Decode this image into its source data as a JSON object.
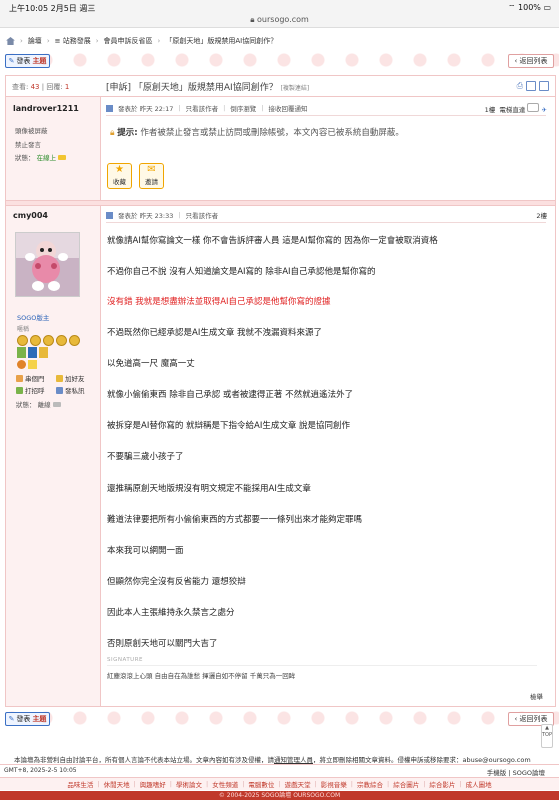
{
  "statusbar": {
    "time": "上午10:05",
    "date": "2月5日 週三",
    "battery": "100%",
    "url": "oursogo.com"
  },
  "breadcrumb": [
    "論壇",
    "站務發展",
    "會員申訴反省區",
    "「原創天地」版規禁用AI協同創作？"
  ],
  "buttons": {
    "post": "發表",
    "post_highlight": "主題",
    "back": "返回列表"
  },
  "thread": {
    "views_label": "查看:",
    "views": "43",
    "replies_label": "回覆:",
    "replies": "1",
    "title": "[申訴] 「原創天地」版規禁用AI協同創作？",
    "copy_link": "[複製連結]"
  },
  "post1": {
    "user": "landrover1211",
    "side": [
      "頭像被屏蔽",
      "禁止發言"
    ],
    "status_label": "狀態：",
    "status": "在線上",
    "meta": [
      "發表於 昨天 22:17",
      "只看該作者",
      "倒序瀏覽",
      "接收回覆通知"
    ],
    "floor": "1樓",
    "floor_extra": "電梯直達",
    "notice_label": "提示:",
    "notice": "作者被禁止發言或禁止訪問或刪除帳號，本文內容已被系統自動屏蔽。",
    "buttons": [
      {
        "icon": "★",
        "label": "收藏"
      },
      {
        "icon": "✉",
        "label": "邀請"
      }
    ]
  },
  "post2": {
    "user": "cmy004",
    "rank": "SOGO版主",
    "level": "暱稱",
    "side_links": [
      "串個門",
      "加好友",
      "打招呼",
      "發私訊"
    ],
    "status_label": "狀態：",
    "status": "離線",
    "meta": [
      "發表於 昨天 23:33",
      "只看該作者"
    ],
    "floor": "2樓",
    "lines": [
      {
        "text": "就像請AI幫你寫論文一樣 你不會告訴評審人員 這是AI幫你寫的 因為你一定會被取消資格",
        "red": false
      },
      {
        "text": "不過你自己不說 沒有人知道論文是AI寫的 除非AI自己承認他是幫你寫的",
        "red": false
      },
      {
        "text": "沒有錯 我就是想盡辦法並取得AI自己承認是他幫你寫的證據",
        "red": true
      },
      {
        "text": "不過既然你已經承認是AI生成文章 我就不洩漏資料來源了",
        "red": false
      },
      {
        "text": "以免道高一尺 魔高一丈",
        "red": false
      },
      {
        "text": "就像小偷偷東西 除非自己承認 或者被逮得正著 不然就逍遙法外了",
        "red": false
      },
      {
        "text": "被拆穿是AI替你寫的 就辯稱是下指令給AI生成文章 說是協同創作",
        "red": false
      },
      {
        "text": "不要騙三歲小孩子了",
        "red": false
      },
      {
        "text": "還推稱原創天地版規沒有明文規定不能採用AI生成文章",
        "red": false
      },
      {
        "text": "難道法律要把所有小偷偷東西的方式都要一一條列出來才能夠定罪嗎",
        "red": false
      },
      {
        "text": "本來我可以網開一面",
        "red": false
      },
      {
        "text": "但顯然你完全沒有反省能力 還想狡辯",
        "red": false
      },
      {
        "text": "因此本人主張維持永久禁言之處分",
        "red": false
      },
      {
        "text": "否則原創天地可以關門大吉了",
        "red": false
      }
    ],
    "signature_label": "SIGNATURE",
    "signature": "紅塵滾滾上心頭 自由自在為誰愁 揮灑自如不停留 千萬只為一回眸",
    "report": "檢舉"
  },
  "footer": {
    "note_pre": "本論壇為非營利自由討論平台，所有個人言論不代表本站立場。文章內容如有涉及侵權，請",
    "note_link": "通知管理人員",
    "note_post": "，將立即刪除相關文章資料。侵權申訴或移除要求：abuse@oursogo.com",
    "gmt": "GMT+8, 2025-2-5 10:05",
    "mobile": "手機版",
    "forum": "SOGO論壇",
    "nav": [
      "品味生活",
      "休閒天地",
      "興趣嗜好",
      "學術論文",
      "女性頻道",
      "電腦數位",
      "遊戲天堂",
      "影視音樂",
      "宗教綜合",
      "綜合圖片",
      "綜合影片",
      "成人圖地"
    ],
    "copyright": "© 2004-2025 SOGO論壇 OURSOGO.COM",
    "scroll": "TOP"
  }
}
